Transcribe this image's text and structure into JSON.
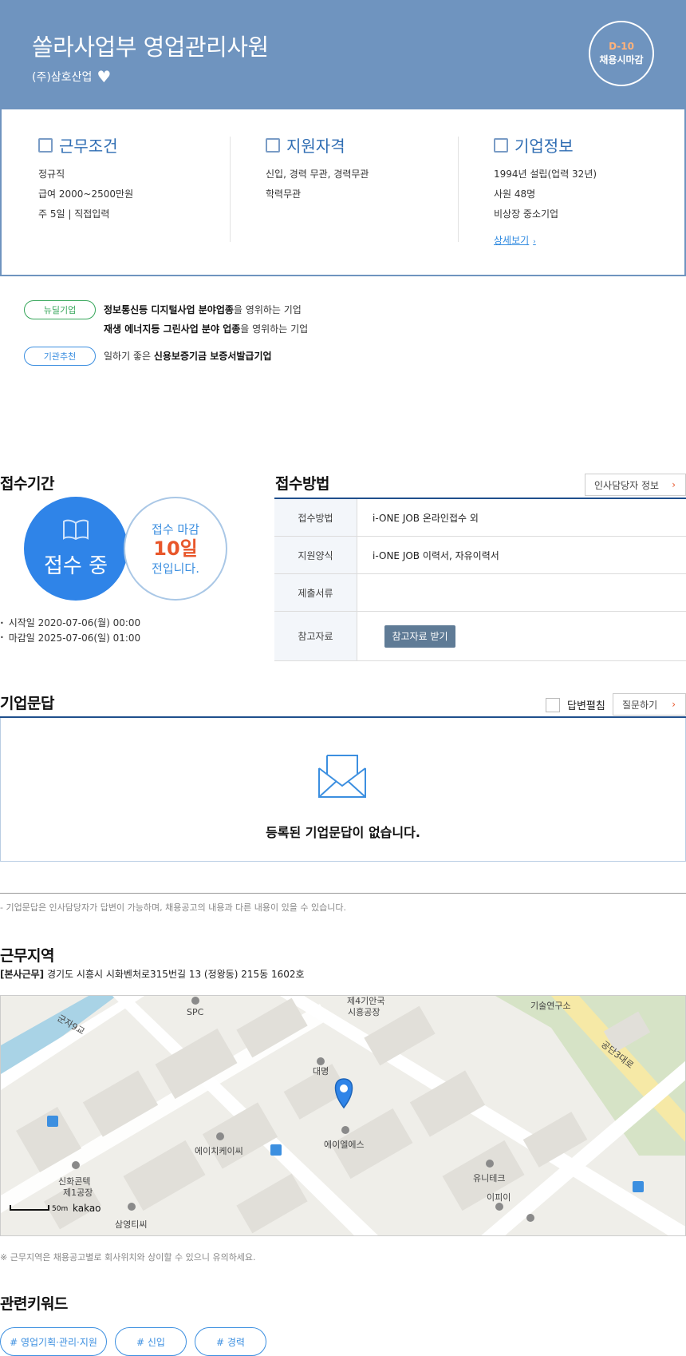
{
  "header": {
    "title": "쏠라사업부 영업관리사원",
    "company": "(주)삼호산업",
    "dday": "D-10",
    "dday_status": "채용시마감"
  },
  "summary": {
    "conditions": {
      "title": "근무조건",
      "lines": [
        "정규직",
        "급여 2000~2500만원",
        "주 5일 | 직접입력"
      ]
    },
    "qualifications": {
      "title": "지원자격",
      "lines": [
        "신입, 경력 무관, 경력무관",
        "학력무관"
      ]
    },
    "company_info": {
      "title": "기업정보",
      "lines": [
        "1994년 설립(업력 32년)",
        "사원 48명",
        "비상장 중소기업"
      ],
      "more_label": "상세보기"
    }
  },
  "tags": [
    {
      "badge": "뉴딜기업",
      "lines": [
        {
          "bold": "정보통신등 디지털사업 분야업종",
          "rest": "을 영위하는 기업"
        },
        {
          "bold": "재생 에너지등 그린사업 분야 업종",
          "rest": "을 영위하는 기업"
        }
      ]
    },
    {
      "badge": "기관추천",
      "lines": [
        {
          "prefix": "일하기 좋은 ",
          "bold": "신용보증기금 보증서발급기업"
        }
      ]
    }
  ],
  "period": {
    "heading": "접수기간",
    "status": "접수 중",
    "remaining_prefix": "접수 마감",
    "remaining_days": "10일",
    "remaining_suffix": "전입니다.",
    "start": "시작일 2020-07-06(월) 00:00",
    "end": "마감일 2025-07-06(일) 01:00"
  },
  "method": {
    "heading": "접수방법",
    "hr_button": "인사담당자 정보",
    "rows": [
      {
        "key": "접수방법",
        "value": "i-ONE JOB 온라인접수 외"
      },
      {
        "key": "지원양식",
        "value": "i-ONE JOB 이력서, 자유이력서"
      },
      {
        "key": "제출서류",
        "value": ""
      },
      {
        "key": "참고자료",
        "value": ""
      }
    ],
    "ref_button": "참고자료 받기"
  },
  "qna": {
    "heading": "기업문답",
    "expand_label": "답변펼침",
    "ask_button": "질문하기",
    "empty_text": "등록된 기업문답이 없습니다.",
    "note": "- 기업문답은 인사담당자가 답변이 가능하며, 채용공고의 내용과 다른 내용이 있을 수 있습니다."
  },
  "location": {
    "heading": "근무지역",
    "addr_label": "[본사근무]",
    "address": "경기도 시흥시 시화벤처로315번길 13 (정왕동) 215동 1602호",
    "note": "※ 근무지역은 채용공고별로 회사위치와 상이할 수 있으니 유의하세요.",
    "map_labels": {
      "road1": "군자9교",
      "spc": "SPC",
      "factory1": "제4기안국",
      "factory2": "시흥공장",
      "lab": "기술연구소",
      "road2": "공단3대로",
      "daemyeong": "대명",
      "hkc": "에이치케이씨",
      "als": "에이엘에스",
      "shinhwa1": "신화콘텍",
      "shinhwa2": "제1공장",
      "unitech": "유니테크",
      "ipi": "이피이",
      "samyoung": "삼영티씨",
      "scale": "50m",
      "brand": "kakao"
    }
  },
  "keywords": {
    "heading": "관련키워드",
    "items": [
      "# 영업기획·관리·지원",
      "# 신입",
      "# 경력"
    ]
  },
  "colors": {
    "header_bg": "#6f94bf",
    "accent_blue": "#2f84e8",
    "accent_orange": "#e8562a",
    "navy_line": "#1f4f8c",
    "green": "#36a65a"
  }
}
